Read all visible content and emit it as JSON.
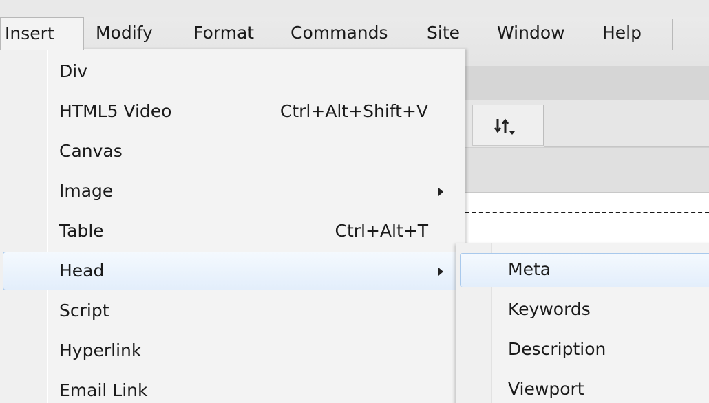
{
  "menubar": {
    "items": [
      {
        "label": "Insert",
        "open": true
      },
      {
        "label": "Modify"
      },
      {
        "label": "Format"
      },
      {
        "label": "Commands"
      },
      {
        "label": "Site"
      },
      {
        "label": "Window"
      },
      {
        "label": "Help"
      }
    ]
  },
  "insert_menu": {
    "items": [
      {
        "label": "Div",
        "shortcut": ""
      },
      {
        "label": "HTML5 Video",
        "shortcut": "Ctrl+Alt+Shift+V"
      },
      {
        "label": "Canvas",
        "shortcut": ""
      },
      {
        "label": "Image",
        "shortcut": "",
        "has_submenu": true
      },
      {
        "label": "Table",
        "shortcut": "Ctrl+Alt+T"
      },
      {
        "label": "Head",
        "shortcut": "",
        "has_submenu": true,
        "highlighted": true
      },
      {
        "label": "Script",
        "shortcut": ""
      },
      {
        "label": "Hyperlink",
        "shortcut": ""
      },
      {
        "label": "Email Link",
        "shortcut": ""
      }
    ]
  },
  "head_submenu": {
    "items": [
      {
        "label": "Meta",
        "highlighted": true
      },
      {
        "label": "Keywords"
      },
      {
        "label": "Description"
      },
      {
        "label": "Viewport"
      }
    ]
  },
  "toolbar": {
    "sort_icon": "sort-arrows-icon"
  }
}
